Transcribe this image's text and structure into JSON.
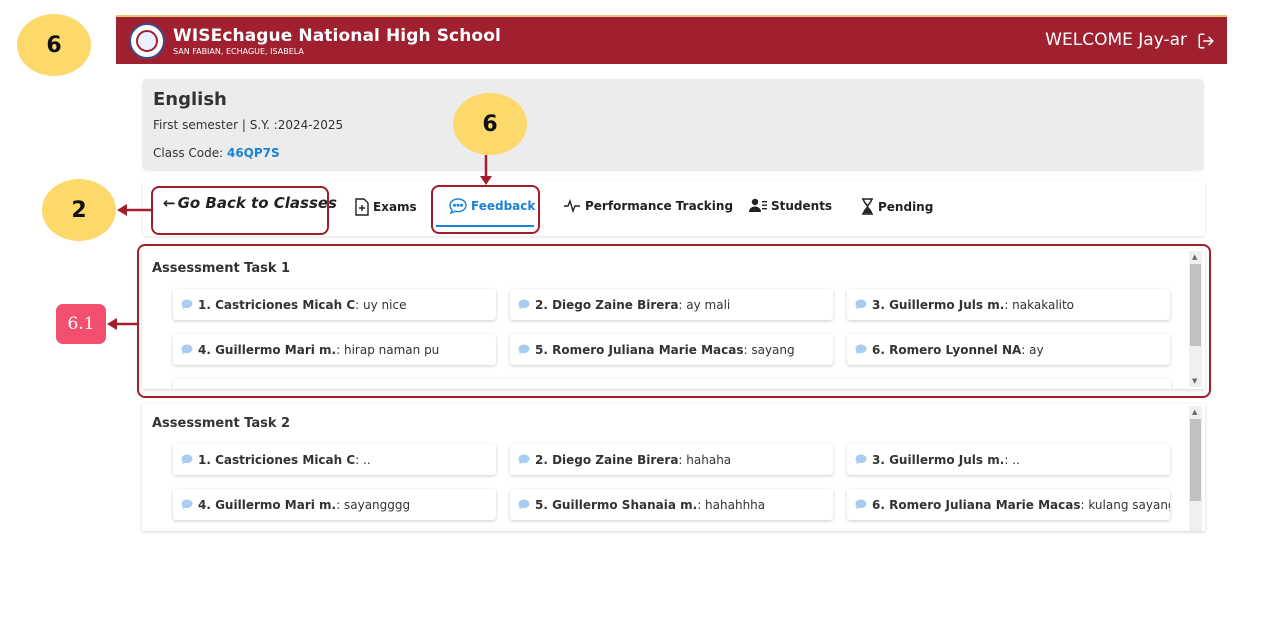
{
  "annotations": {
    "top_left_badge": "6",
    "feedback_badge": "6",
    "goback_badge": "2",
    "task_badge": "6.1"
  },
  "header": {
    "school_name": "WISEchague National High School",
    "school_address": "SAN FABIAN, ECHAGUE, ISABELA",
    "welcome": "WELCOME Jay-ar"
  },
  "class_info": {
    "title": "English",
    "semester": "First semester | S.Y. :2024-2025",
    "code_label": "Class Code: ",
    "code": "46QP7S"
  },
  "tabs": {
    "go_back": "Go Back to Classes",
    "exams": "Exams",
    "feedback": "Feedback",
    "performance": "Performance Tracking",
    "students": "Students",
    "pending": "Pending"
  },
  "tasks": [
    {
      "title": "Assessment Task 1",
      "feedback": [
        {
          "name": "1. Castriciones Micah C",
          "comment": ": uy nice"
        },
        {
          "name": "2. Diego Zaine Birera",
          "comment": ": ay mali"
        },
        {
          "name": "3. Guillermo Juls m.",
          "comment": ": nakakalito"
        },
        {
          "name": "4. Guillermo Mari m.",
          "comment": ": hirap naman pu"
        },
        {
          "name": "5. Romero Juliana Marie Macas",
          "comment": ": sayang"
        },
        {
          "name": "6. Romero Lyonnel NA",
          "comment": ": ay"
        }
      ]
    },
    {
      "title": "Assessment Task 2",
      "feedback": [
        {
          "name": "1. Castriciones Micah C",
          "comment": ": .."
        },
        {
          "name": "2. Diego Zaine Birera",
          "comment": ": hahaha"
        },
        {
          "name": "3. Guillermo Juls m.",
          "comment": ": .."
        },
        {
          "name": "4. Guillermo Mari m.",
          "comment": ": sayangggg"
        },
        {
          "name": "5. Guillermo Shanaia m.",
          "comment": ": hahahhha"
        },
        {
          "name": "6. Romero Juliana Marie Macas",
          "comment": ": kulang sayang"
        }
      ]
    }
  ],
  "colors": {
    "header_bg": "#a1202f",
    "accent": "#1a82d6",
    "badge_yellow": "#fcd96a",
    "badge_pink": "#f0506e"
  },
  "icons": [
    "logout-icon",
    "exam-icon",
    "chat-icon",
    "pulse-icon",
    "students-icon",
    "hourglass-icon",
    "comment-icon",
    "arrow-left-icon"
  ]
}
